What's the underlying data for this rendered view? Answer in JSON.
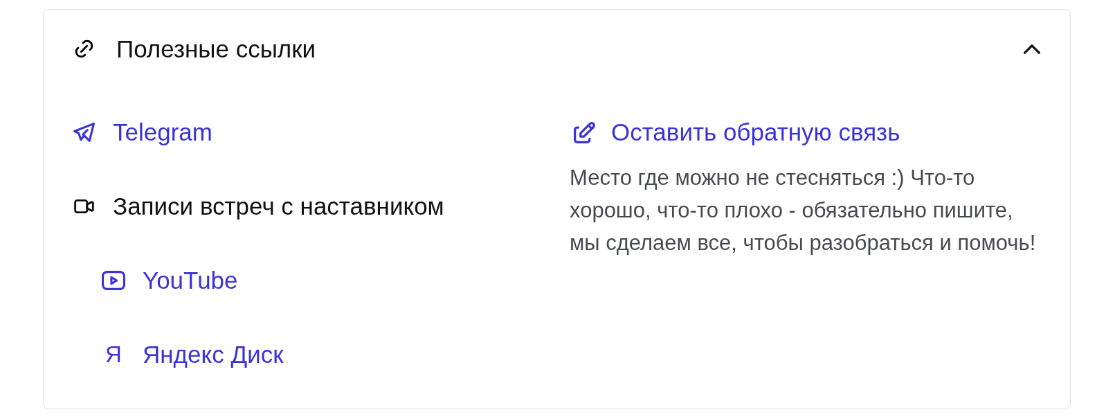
{
  "section": {
    "title": "Полезные ссылки",
    "expanded": true
  },
  "links": [
    {
      "kind": "link",
      "label": "Telegram"
    },
    {
      "kind": "group",
      "label": "Записи встреч с наставником",
      "children": [
        {
          "kind": "link",
          "label": "YouTube"
        },
        {
          "kind": "link",
          "label": "Яндекс Диск",
          "glyph": "Я"
        }
      ]
    }
  ],
  "feedback": {
    "label": "Оставить обратную связь",
    "description": "Место где можно не стесняться :) Что-то хорошо, что-то плохо - обязательно пишите, мы сделаем все, чтобы разобраться и помочь!"
  }
}
